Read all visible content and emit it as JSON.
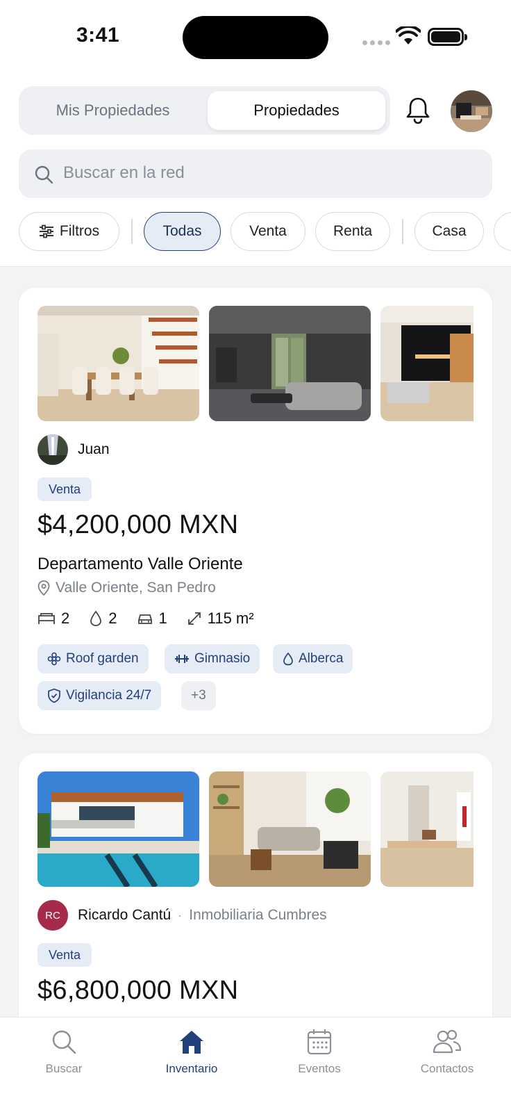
{
  "status_bar": {
    "time": "3:41"
  },
  "header": {
    "segments": [
      "Mis Propiedades",
      "Propiedades"
    ],
    "active_segment": "Propiedades"
  },
  "search": {
    "placeholder": "Buscar en la red"
  },
  "filters": {
    "filter_label": "Filtros",
    "chips": [
      "Todas",
      "Venta",
      "Renta",
      "Casa"
    ],
    "active_chip": "Todas"
  },
  "listings": [
    {
      "owner": "Juan",
      "company": "",
      "tag": "Venta",
      "price": "$4,200,000 MXN",
      "title": "Departamento Valle Oriente",
      "location": "Valle Oriente, San Pedro",
      "bedrooms": "2",
      "bathrooms": "2",
      "parking": "1",
      "area": "115 m²",
      "amenities": [
        "Roof garden",
        "Gimnasio",
        "Alberca",
        "Vigilancia 24/7"
      ],
      "more_amenities": "+3"
    },
    {
      "owner": "Ricardo Cantú",
      "owner_initials": "RC",
      "company": "Inmobiliaria Cumbres",
      "tag": "Venta",
      "price": "$6,800,000 MXN"
    }
  ],
  "tabbar": {
    "tabs": [
      "Buscar",
      "Inventario",
      "Eventos",
      "Contactos"
    ],
    "active": "Inventario"
  },
  "colors": {
    "accent": "#22407a",
    "chip_active_bg": "#e6ecf6",
    "initials_avatar": "#a62a4a"
  }
}
